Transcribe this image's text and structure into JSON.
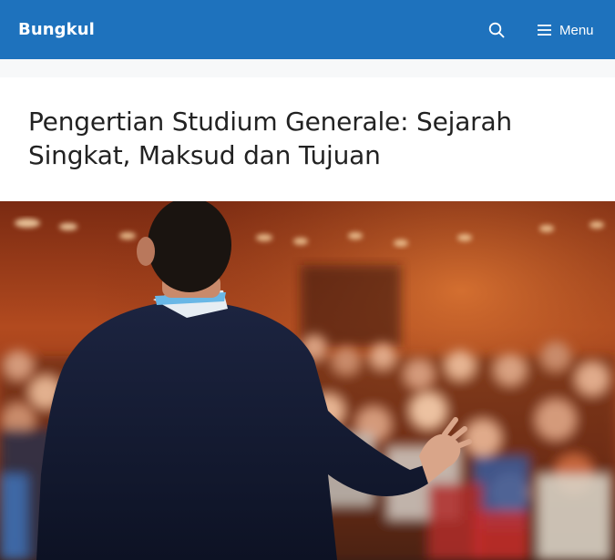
{
  "header": {
    "brand": "Bungkul",
    "search_icon": "search-icon",
    "menu_icon": "hamburger-icon",
    "menu_label": "Menu"
  },
  "article": {
    "title": "Pengertian Studium Generale: Sejarah Singkat, Maksud dan Tujuan",
    "featured_image": "speaker-presenting-to-conference-audience"
  },
  "colors": {
    "header_bg": "#1e72bd",
    "page_bg": "#f7f8f9",
    "title_text": "#222222"
  }
}
